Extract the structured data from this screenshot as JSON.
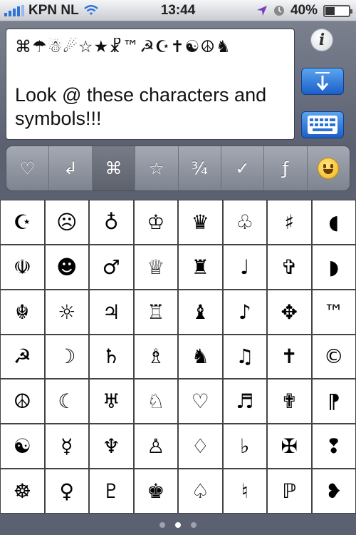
{
  "status": {
    "carrier": "KPN NL",
    "time": "13:44",
    "battery": "40%",
    "battery_level": 0.4
  },
  "editor": {
    "symbols_line": "⌘☂☃☄☆★☧™☭☪✝☯☮♞",
    "body_text": "Look @ these characters and symbols!!!"
  },
  "buttons": {
    "info": "i"
  },
  "categories": [
    {
      "symbol": "♡",
      "active": false
    },
    {
      "symbol": "↲",
      "active": false
    },
    {
      "symbol": "⌘",
      "active": true
    },
    {
      "symbol": "☆",
      "active": false
    },
    {
      "symbol": "¾",
      "active": false
    },
    {
      "symbol": "✓",
      "active": false
    },
    {
      "symbol": "ƒ",
      "active": false
    },
    {
      "symbol": "emoji",
      "active": false
    }
  ],
  "grid": [
    [
      "☪",
      "☹",
      "♁",
      "♔",
      "♛",
      "♧",
      "♯",
      "◖"
    ],
    [
      "☫",
      "☻",
      "♂",
      "♕",
      "♜",
      "♩",
      "✞",
      "◗"
    ],
    [
      "☬",
      "☼",
      "♃",
      "♖",
      "♝",
      "♪",
      "✥",
      "™"
    ],
    [
      "☭",
      "☽",
      "♄",
      "♗",
      "♞",
      "♫",
      "✝",
      "©"
    ],
    [
      "☮",
      "☾",
      "♅",
      "♘",
      "♡",
      "♬",
      "✟",
      "⁋"
    ],
    [
      "☯",
      "☿",
      "♆",
      "♙",
      "♢",
      "♭",
      "✠",
      "❢"
    ],
    [
      "☸",
      "♀",
      "♇",
      "♚",
      "♤",
      "♮",
      "ℙ",
      "❥"
    ]
  ],
  "pager": {
    "count": 3,
    "active": 1
  },
  "colors": {
    "accent_blue": "#2a72d8",
    "battery_fill": "#333333"
  }
}
